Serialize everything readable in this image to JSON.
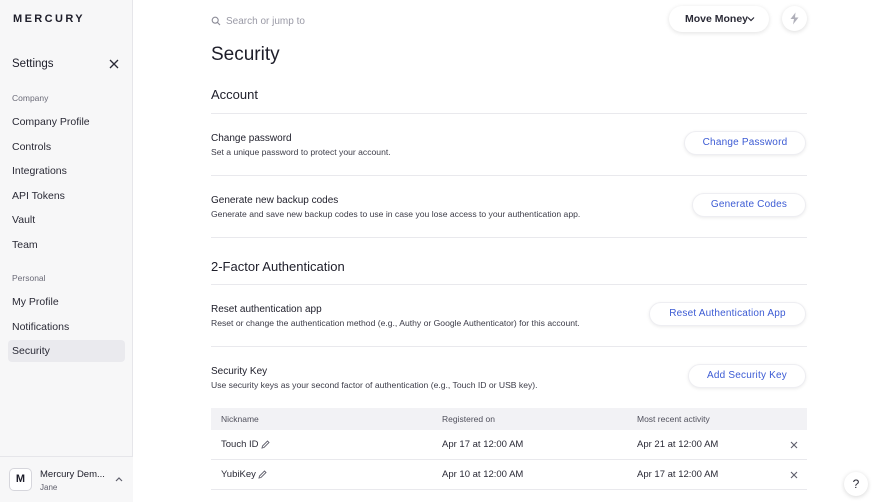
{
  "sidebar": {
    "logo": "MERCURY",
    "title": "Settings",
    "company_label": "Company",
    "company_items": [
      "Company Profile",
      "Controls",
      "Integrations",
      "API Tokens",
      "Vault",
      "Team"
    ],
    "personal_label": "Personal",
    "personal_items": [
      "My Profile",
      "Notifications",
      "Security"
    ],
    "active_item": "Security",
    "account": {
      "initial": "M",
      "name": "Mercury Dem...",
      "user": "Jane"
    }
  },
  "topbar": {
    "search_placeholder": "Search or jump to",
    "move_money_label": "Move Money"
  },
  "page": {
    "title": "Security",
    "account_section": "Account",
    "change_password": {
      "title": "Change password",
      "description": "Set a unique password to protect your account.",
      "button": "Change Password"
    },
    "backup_codes": {
      "title": "Generate new backup codes",
      "description": "Generate and save new backup codes to use in case you lose access to your authentication app.",
      "button": "Generate Codes"
    },
    "twofa_section": "2-Factor Authentication",
    "reset_app": {
      "title": "Reset authentication app",
      "description": "Reset or change the authentication method (e.g., Authy or Google Authenticator) for this account.",
      "button": "Reset Authentication App"
    },
    "security_key": {
      "title": "Security Key",
      "description": "Use security keys as your second factor of authentication (e.g., Touch ID or USB key).",
      "button": "Add Security Key"
    },
    "table": {
      "headers": [
        "Nickname",
        "Registered on",
        "Most recent activity"
      ],
      "rows": [
        {
          "nickname": "Touch ID",
          "registered": "Apr 17 at 12:00 AM",
          "recent": "Apr 21 at 12:00 AM"
        },
        {
          "nickname": "YubiKey",
          "registered": "Apr 10 at 12:00 AM",
          "recent": "Apr 17 at 12:00 AM"
        }
      ]
    }
  },
  "help_label": "?",
  "colors": {
    "accent": "#3c5bd4",
    "sidebar_bg": "#f7f7f8",
    "active_bg": "#eaeaee"
  },
  "icons": [
    "close-icon",
    "search-icon",
    "chevron-down-icon",
    "lightning-icon",
    "pencil-icon",
    "remove-icon",
    "chevron-up-icon"
  ]
}
